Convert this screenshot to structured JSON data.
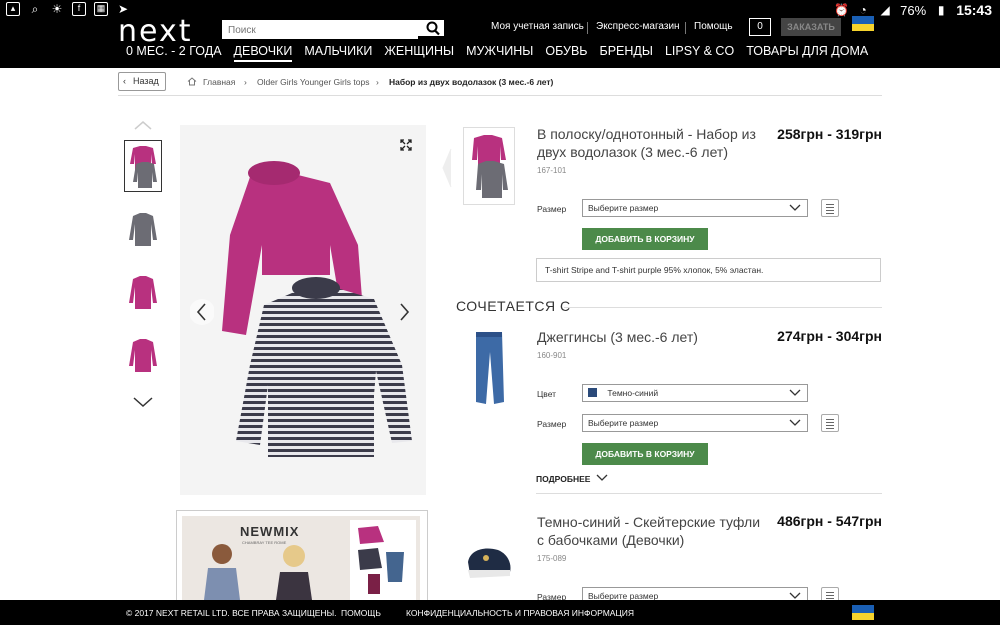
{
  "status_bar": {
    "battery": "76%",
    "time": "15:43"
  },
  "header": {
    "logo": "next",
    "search_placeholder": "Поиск",
    "account": "Моя учетная запись",
    "express": "Экспресс-магазин",
    "help": "Помощь",
    "bag_count": "0",
    "checkout": "ЗАКАЗАТЬ",
    "nav": [
      "0 МЕС. - 2 ГОДА",
      "ДЕВОЧКИ",
      "МАЛЬЧИКИ",
      "ЖЕНЩИНЫ",
      "МУЖЧИНЫ",
      "ОБУВЬ",
      "БРЕНДЫ",
      "LIPSY & CO",
      "ТОВАРЫ ДЛЯ ДОМА"
    ]
  },
  "breadcrumb": {
    "back": "Назад",
    "home": "Главная",
    "category": "Older Girls Younger Girls tops",
    "current": "Набор из двух водолазок (3 мес.-6 лет)"
  },
  "banner": {
    "title": "NEWMIX",
    "subtitle": "CHAMBRAY TEE ROME"
  },
  "product": {
    "title": "В полоску/однотонный - Набор из двух водолазок (3 мес.-6 лет)",
    "price": "258грн - 319грн",
    "code": "167-101",
    "size_label": "Размер",
    "size_placeholder": "Выберите размер",
    "add_to_cart": "ДОБАВИТЬ В КОРЗИНУ",
    "description": "T-shirt Stripe and T-shirt purple 95% хлопок, 5% эластан."
  },
  "pairs_with": {
    "heading": "СОЧЕТАЕТСЯ С",
    "items": [
      {
        "title": "Джеггинсы (3 мес.-6 лет)",
        "price": "274грн - 304грн",
        "code": "160-901",
        "color_label": "Цвет",
        "color_value": "Темно-синий",
        "size_label": "Размер",
        "size_placeholder": "Выберите размер",
        "add_to_cart": "ДОБАВИТЬ В КОРЗИНУ",
        "more": "ПОДРОБНЕЕ"
      },
      {
        "title": "Темно-синий - Скейтерские туфли с бабочками (Девочки)",
        "price": "486грн - 547грн",
        "code": "175-089",
        "size_label": "Размер",
        "size_placeholder": "Выберите размер"
      }
    ]
  },
  "footer": {
    "copyright": "© 2017 NEXT RETAIL LTD. ВСЕ ПРАВА ЗАЩИЩЕНЫ.",
    "help": "ПОМОЩЬ",
    "privacy": "КОНФИДЕНЦИАЛЬНОСТЬ И ПРАВОВАЯ ИНФОРМАЦИЯ"
  },
  "colors": {
    "accent_green": "#4c8a4a",
    "header_bg": "#000000",
    "sweater_purple": "#b8317f",
    "navy": "#2b4a7a"
  }
}
